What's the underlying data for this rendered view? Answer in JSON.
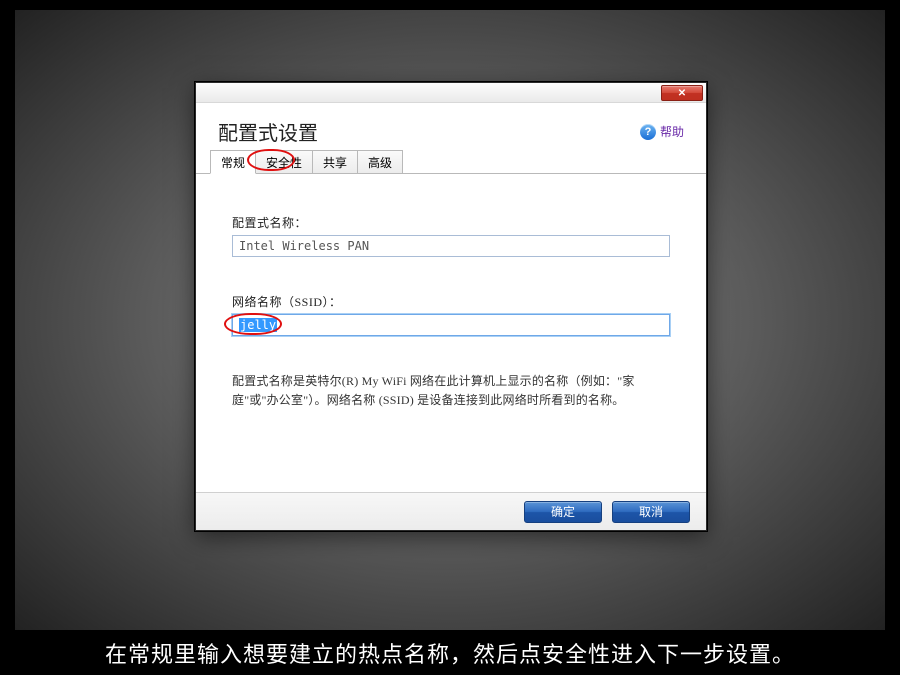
{
  "dialog": {
    "title": "配置式设置",
    "help_label": "帮助",
    "tabs": {
      "general": "常规",
      "security": "安全性",
      "sharing": "共享",
      "advanced": "高级"
    },
    "fields": {
      "profile_name_label": "配置式名称：",
      "profile_name_value": "Intel Wireless PAN",
      "ssid_label": "网络名称（SSID）：",
      "ssid_value": "jelly"
    },
    "description": "配置式名称是英特尔(R) My WiFi 网络在此计算机上显示的名称（例如：\"家庭\"或\"办公室\"）。网络名称 (SSID) 是设备连接到此网络时所看到的名称。",
    "buttons": {
      "ok": "确定",
      "cancel": "取消"
    },
    "close_glyph": "✕"
  },
  "caption": "在常规里输入想要建立的热点名称，然后点安全性进入下一步设置。"
}
